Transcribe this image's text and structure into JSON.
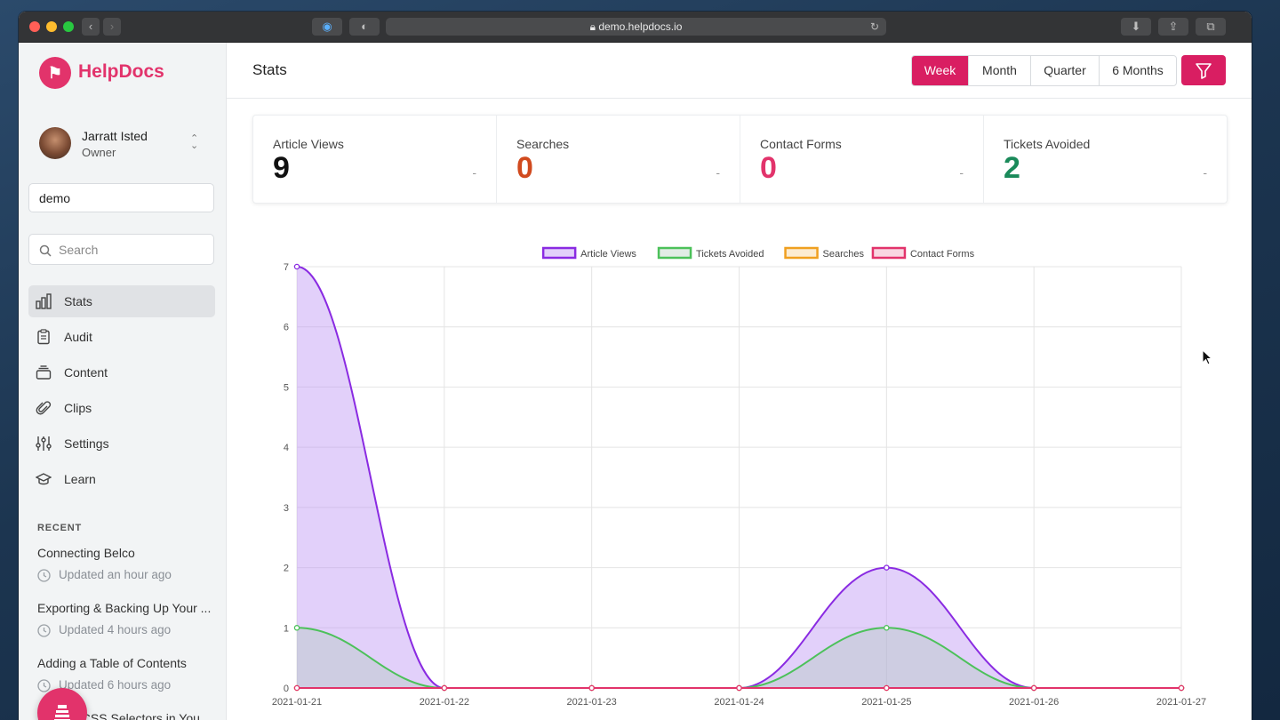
{
  "browser": {
    "url": "demo.helpdocs.io"
  },
  "brand": {
    "name": "HelpDocs",
    "color": "#e2336b"
  },
  "user": {
    "name": "Jarratt Isted",
    "role": "Owner"
  },
  "site_value": "demo",
  "search": {
    "placeholder": "Search"
  },
  "nav": [
    {
      "label": "Stats",
      "icon": "bar-chart-icon"
    },
    {
      "label": "Audit",
      "icon": "clipboard-icon"
    },
    {
      "label": "Content",
      "icon": "stack-icon"
    },
    {
      "label": "Clips",
      "icon": "paperclip-icon"
    },
    {
      "label": "Settings",
      "icon": "sliders-icon"
    },
    {
      "label": "Learn",
      "icon": "graduation-cap-icon"
    }
  ],
  "recent": {
    "heading": "RECENT",
    "items": [
      {
        "title": "Connecting Belco",
        "meta": "Updated an hour ago"
      },
      {
        "title": "Exporting & Backing Up Your ...",
        "meta": "Updated 4 hours ago"
      },
      {
        "title": "Adding a Table of Contents",
        "meta": "Updated 6 hours ago"
      },
      {
        "title": "Finding CSS Selectors in You...",
        "meta": ""
      }
    ]
  },
  "page": {
    "title": "Stats"
  },
  "ranges": [
    "Week",
    "Month",
    "Quarter",
    "6 Months"
  ],
  "stats": [
    {
      "label": "Article Views",
      "value": "9",
      "delta": "-",
      "color": "#111111"
    },
    {
      "label": "Searches",
      "value": "0",
      "delta": "-",
      "color": "#d14a1e"
    },
    {
      "label": "Contact Forms",
      "value": "0",
      "delta": "-",
      "color": "#e2336b"
    },
    {
      "label": "Tickets Avoided",
      "value": "2",
      "delta": "-",
      "color": "#1a8a5a"
    }
  ],
  "chart_data": {
    "type": "area",
    "x": [
      "2021-01-21",
      "2021-01-22",
      "2021-01-23",
      "2021-01-24",
      "2021-01-25",
      "2021-01-26",
      "2021-01-27"
    ],
    "ylim": [
      0,
      7
    ],
    "yticks": [
      0,
      1,
      2,
      3,
      4,
      5,
      6,
      7
    ],
    "grid": true,
    "legend": "top-center",
    "series": [
      {
        "name": "Article Views",
        "values": [
          7,
          0,
          0,
          0,
          2,
          0,
          0
        ],
        "color": "#8a2be2",
        "fill": "rgba(190,150,245,0.45)"
      },
      {
        "name": "Tickets Avoided",
        "values": [
          1,
          0,
          0,
          0,
          1,
          0,
          0
        ],
        "color": "#4cc15a",
        "fill": "rgba(170,200,180,0.35)"
      },
      {
        "name": "Searches",
        "values": [
          0,
          0,
          0,
          0,
          0,
          0,
          0
        ],
        "color": "#f0a020",
        "fill": "rgba(240,160,32,0.2)"
      },
      {
        "name": "Contact Forms",
        "values": [
          0,
          0,
          0,
          0,
          0,
          0,
          0
        ],
        "color": "#e2336b",
        "fill": "rgba(226,51,107,0.2)"
      }
    ]
  }
}
